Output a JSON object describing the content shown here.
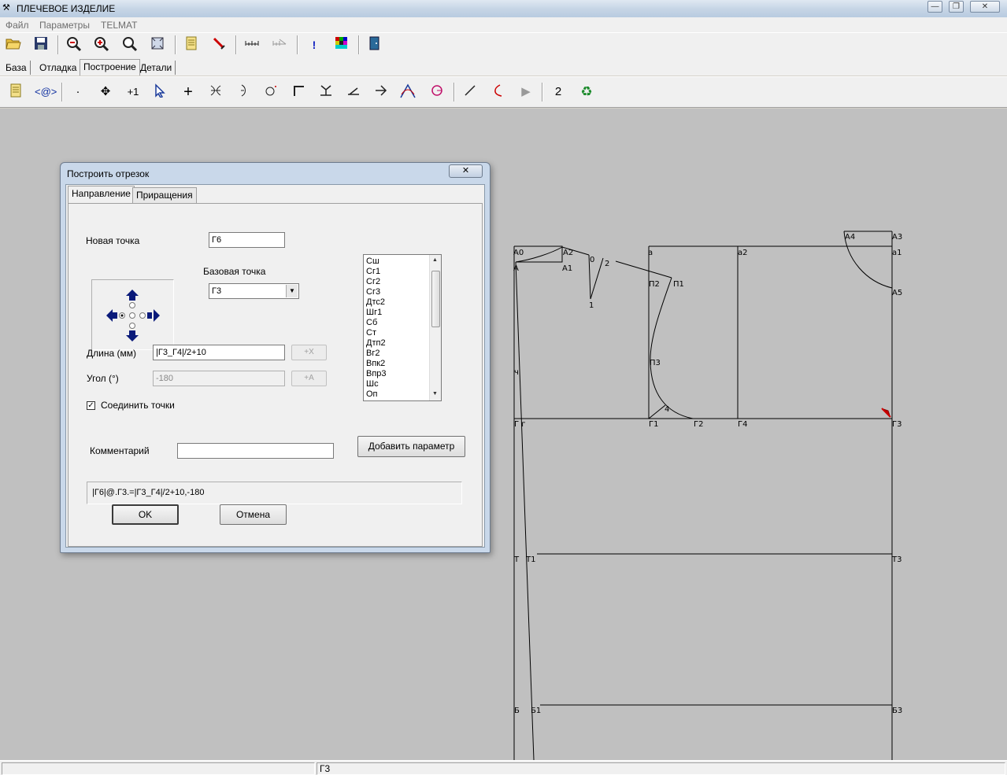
{
  "window": {
    "title": "ПЛЕЧЕВОЕ ИЗДЕЛИЕ",
    "minimize_glyph": "—",
    "maximize_glyph": "❐",
    "close_glyph": "✕"
  },
  "menu": [
    "Файл",
    "Параметры",
    "TELMAT"
  ],
  "module_tabs": [
    "База",
    "Отладка",
    "Построение",
    "Детали"
  ],
  "module_tabs_active": "Построение",
  "toolbar2_counter": "2",
  "dialog": {
    "title": "Построить отрезок",
    "close_glyph": "✕",
    "tabs": [
      "Направление",
      "Приращения"
    ],
    "active_tab": "Направление",
    "new_point_label": "Новая точка",
    "new_point_value": "Г6",
    "base_point_label": "Базовая точка",
    "base_point_value": "Г3",
    "length_label": "Длина (мм)",
    "length_value": "|Г3_Г4|/2+10",
    "length_btn": "+X",
    "angle_label": "Угол (°)",
    "angle_value": "-180",
    "angle_btn": "+A",
    "connect_label": "Соединить точки",
    "connect_checked": true,
    "comment_label": "Комментарий",
    "comment_value": "",
    "add_param_btn": "Добавить параметр",
    "command_text": "|Г6|@.Г3.=|Г3_Г4|/2+10,-180",
    "ok_btn": "OK",
    "cancel_btn": "Отмена",
    "param_list": [
      "Сш",
      "Сг1",
      "Сг2",
      "Сг3",
      "Дтс2",
      "Шг1",
      "Сб",
      "Ст",
      "Дтп2",
      "Вг2",
      "Впк2",
      "Впр3",
      "Шс",
      "Оп"
    ]
  },
  "status": {
    "panel1": "",
    "panel2": "Г3"
  },
  "drawing_labels": {
    "A0": "А0",
    "A": "А",
    "A1": "А1",
    "A2": "А2",
    "n0": "0",
    "n1": "1",
    "n2": "2",
    "a": "а",
    "P2": "П2",
    "P1": "П1",
    "a2": "а2",
    "A4": "А4",
    "A3": "А3",
    "a1": "а1",
    "A5": "А5",
    "P3": "П3",
    "n4": "4",
    "Gg": "Г г",
    "G1": "Г1",
    "G2": "Г2",
    "G4": "Г4",
    "G3": "Г3",
    "T": "Т",
    "T1": "Т1",
    "T3": "Т3",
    "B": "Б",
    "B1": "Б1",
    "B3": "Б3",
    "u": "ч"
  }
}
